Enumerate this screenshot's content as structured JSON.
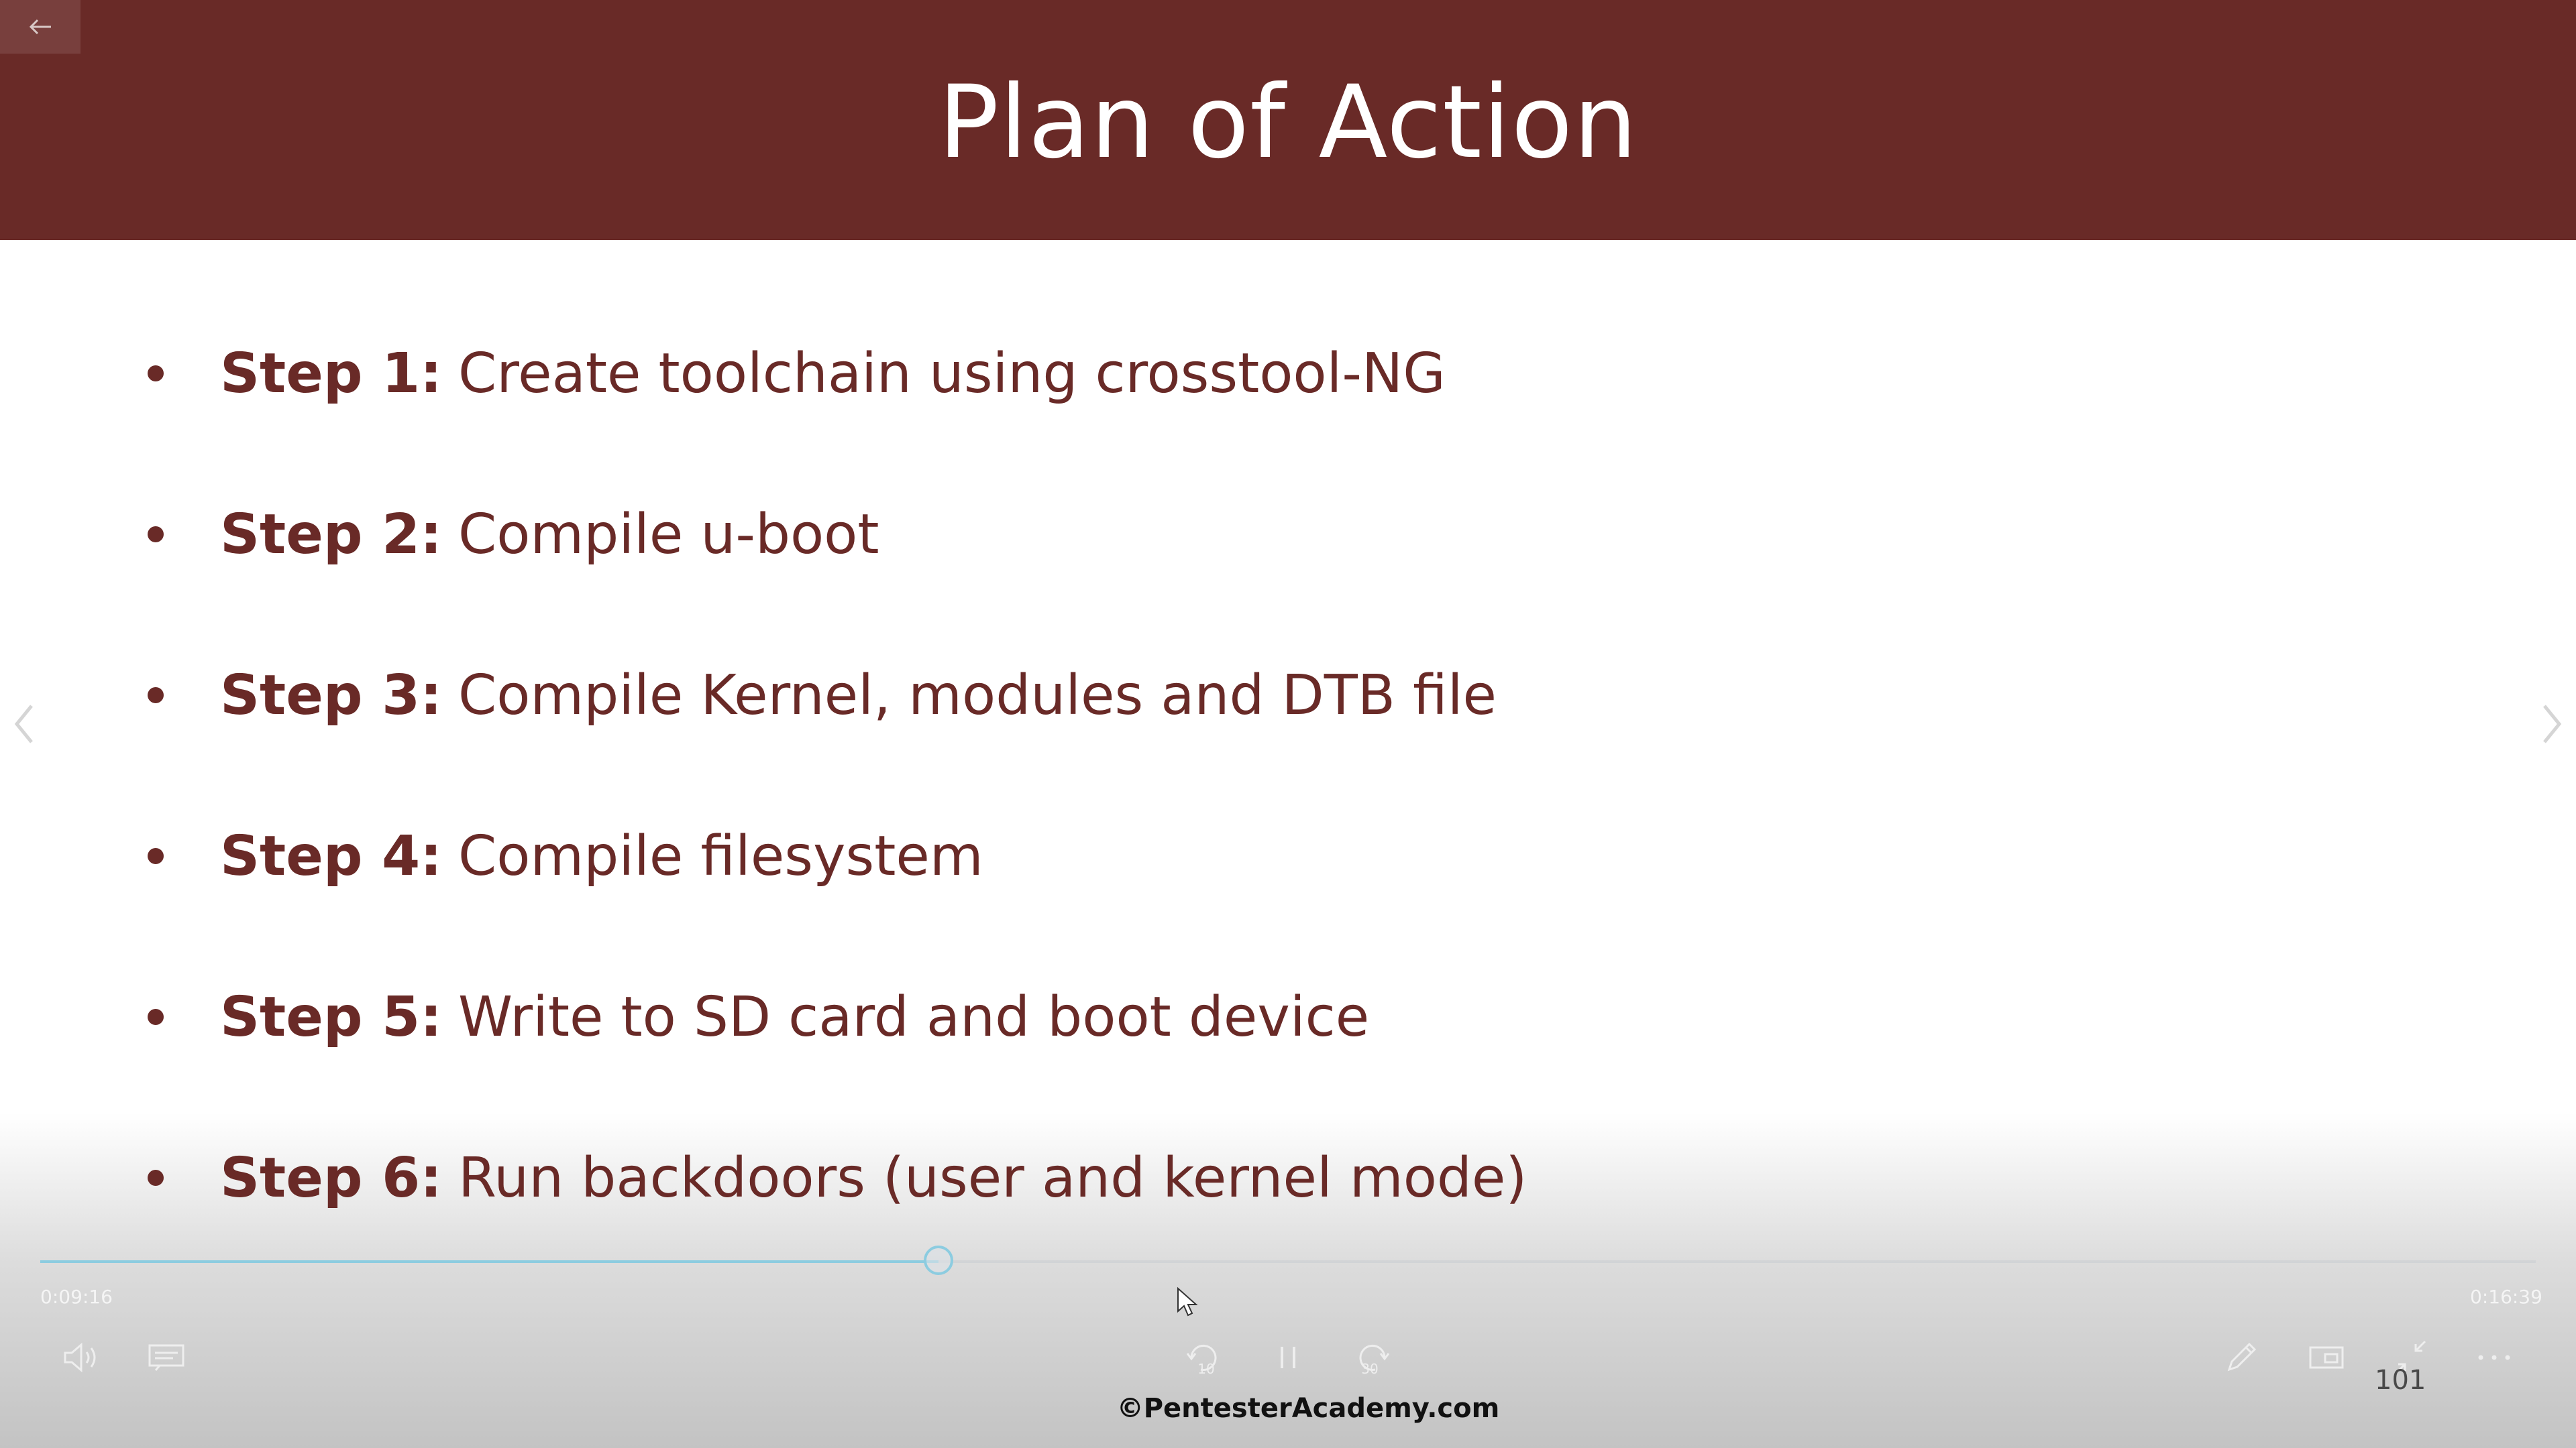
{
  "slide": {
    "title": "Plan of Action",
    "steps": [
      {
        "label": "Step 1:",
        "text": "Create toolchain using crosstool-NG"
      },
      {
        "label": "Step 2:",
        "text": "Compile u-boot"
      },
      {
        "label": "Step 3:",
        "text": "Compile Kernel, modules and DTB file"
      },
      {
        "label": "Step 4:",
        "text": "Compile filesystem"
      },
      {
        "label": "Step 5:",
        "text": "Write to SD card and boot device"
      },
      {
        "label": "Step 6:",
        "text": "Run backdoors (user and kernel mode)"
      }
    ],
    "footer": "©PentesterAcademy.com",
    "slide_number": "101"
  },
  "player": {
    "elapsed": "0:09:16",
    "remaining": "0:16:39",
    "progress_fraction": 0.36,
    "skip_back_label": "10",
    "skip_forward_label": "30"
  },
  "colors": {
    "title_bar": "#692a27",
    "step_text": "#692a27",
    "progress": "#8ccce0"
  },
  "icons": {
    "back": "arrow-left-icon",
    "prev_slide": "chevron-left-icon",
    "next_slide": "chevron-right-icon",
    "volume": "volume-icon",
    "captions": "captions-icon",
    "skip_back": "skip-back-10-icon",
    "pause": "pause-icon",
    "skip_forward": "skip-forward-30-icon",
    "pen": "pen-icon",
    "mini_player": "mini-player-icon",
    "fullscreen_exit": "exit-fullscreen-icon",
    "more": "more-options-icon"
  }
}
